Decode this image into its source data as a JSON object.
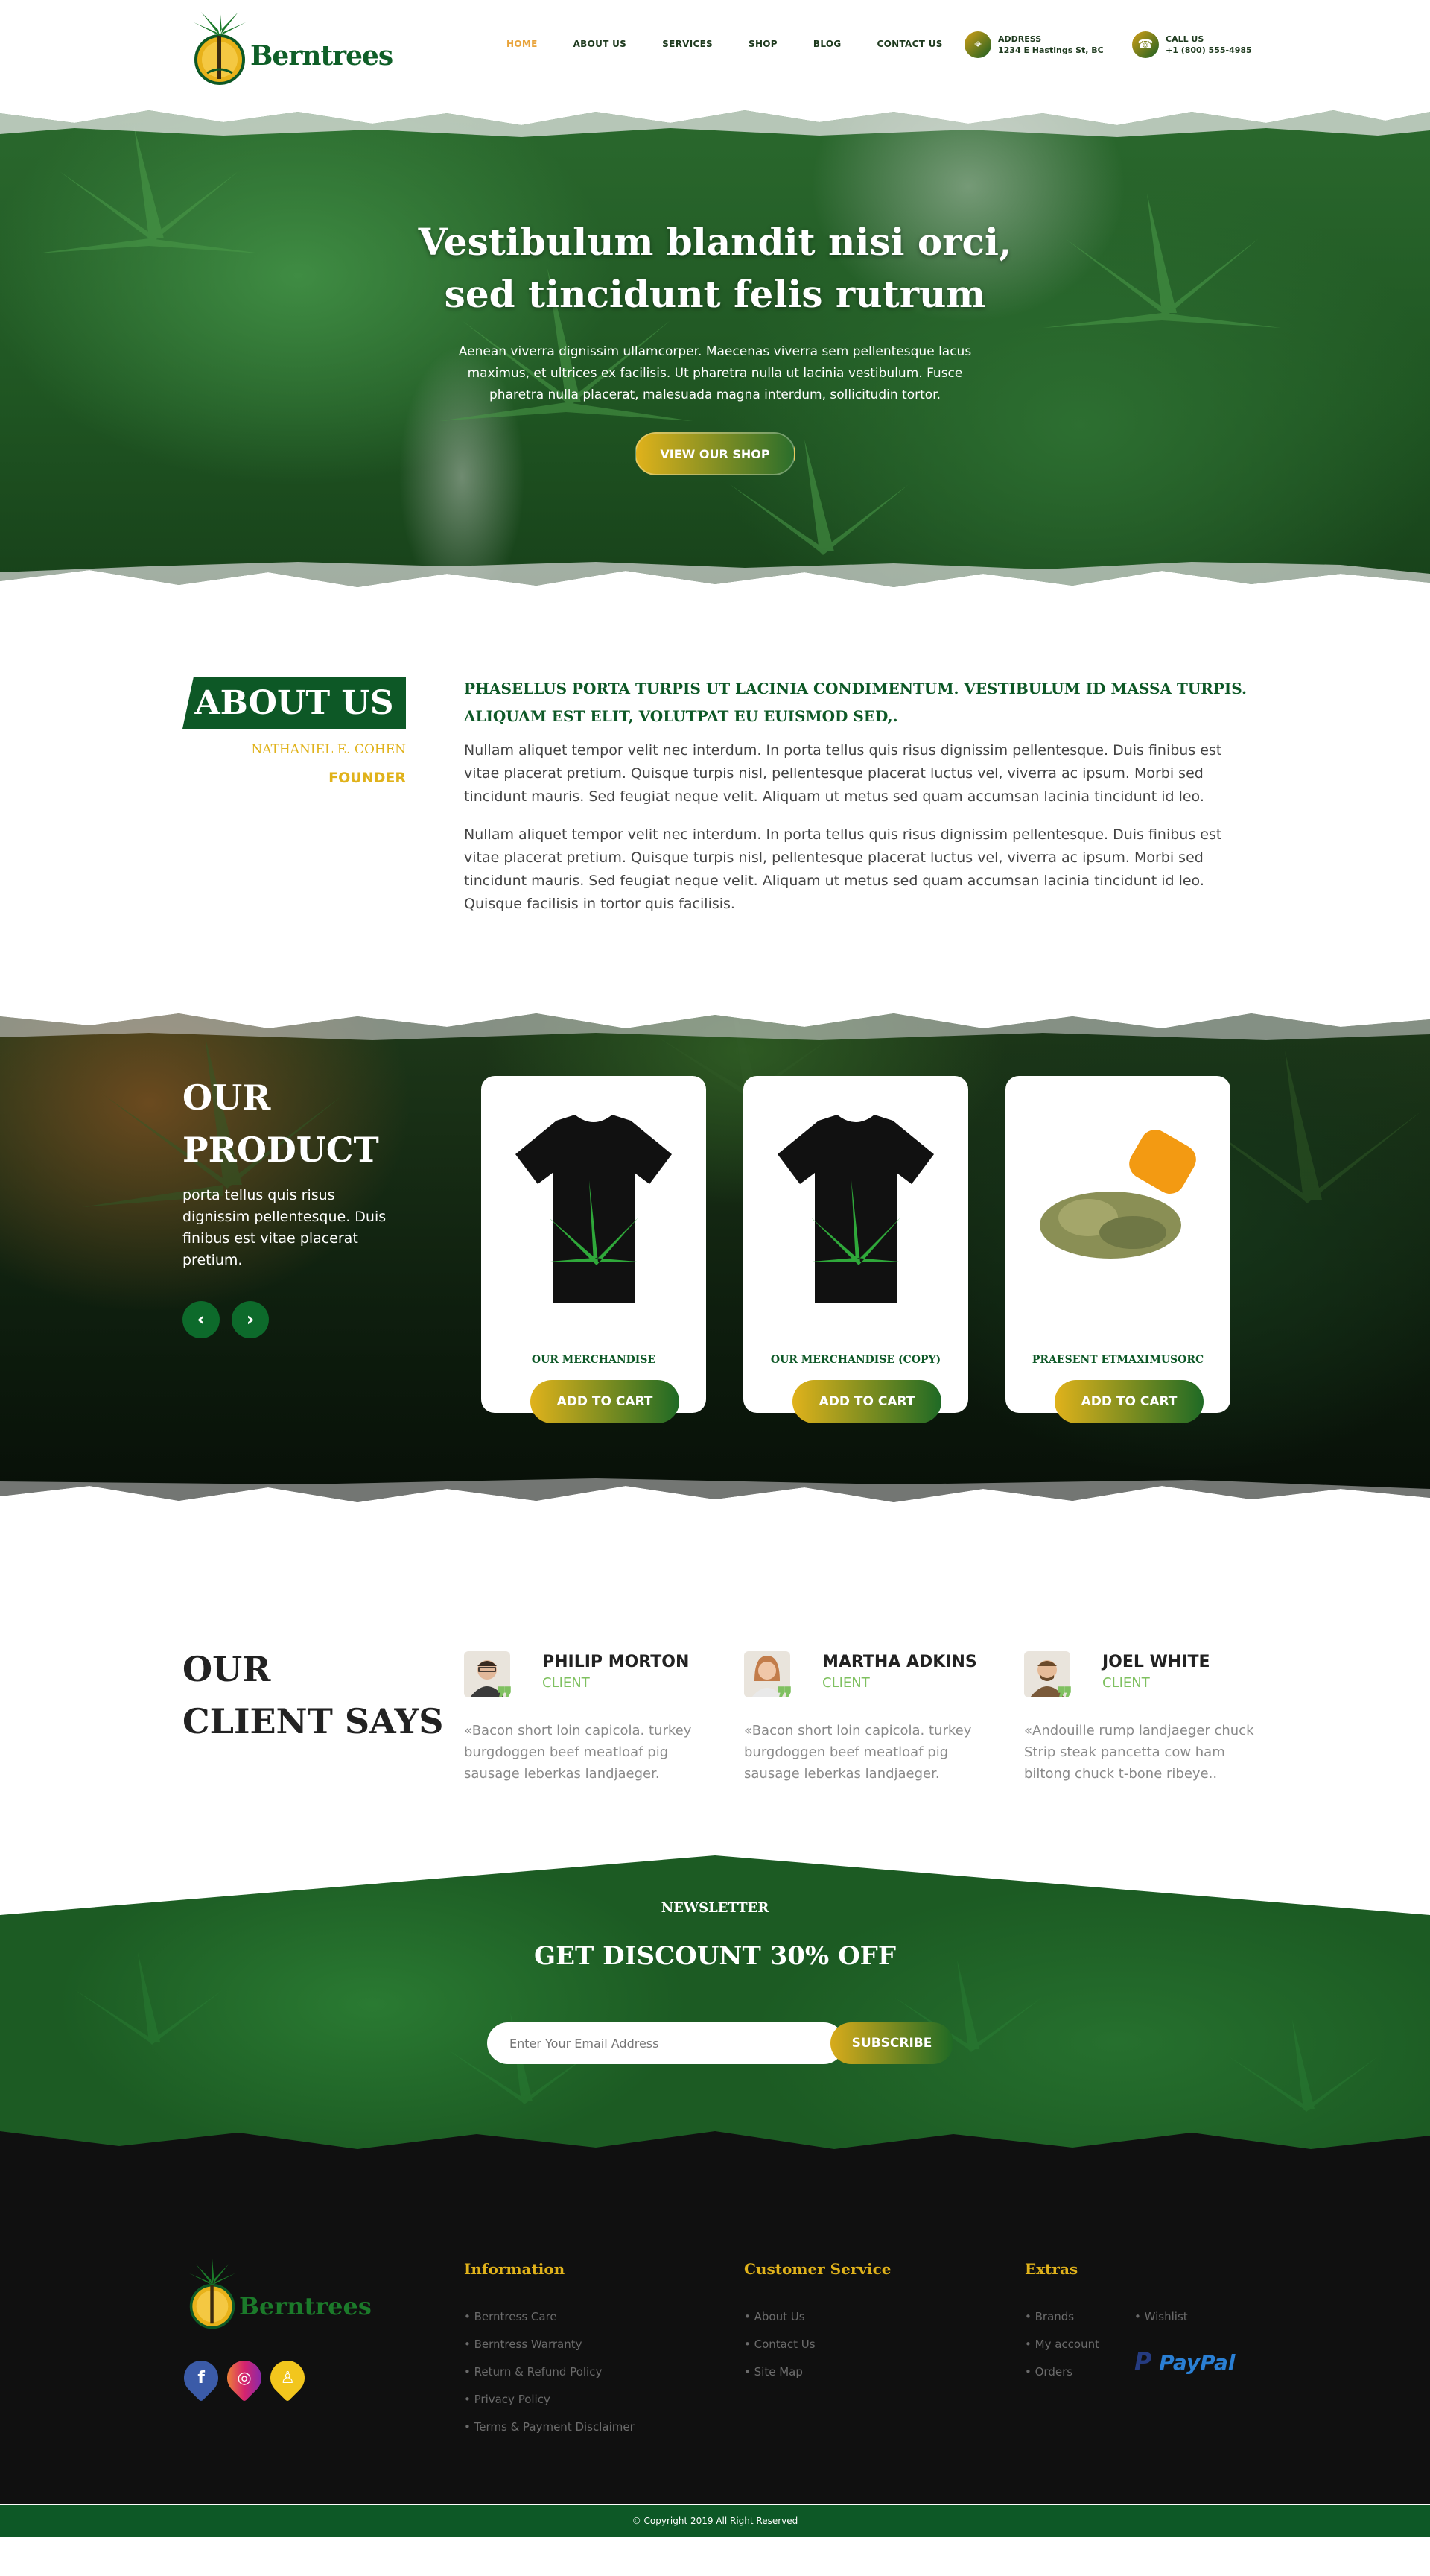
{
  "header": {
    "logo_text": "Berntrees",
    "nav": [
      {
        "label": "HOME",
        "active": true
      },
      {
        "label": "ABOUT US",
        "active": false
      },
      {
        "label": "SERVICES",
        "active": false
      },
      {
        "label": "SHOP",
        "active": false
      },
      {
        "label": "BLOG",
        "active": false
      },
      {
        "label": "CONTACT US",
        "active": false
      }
    ],
    "address_label": "ADDRESS",
    "address_value": "1234 E Hastings St, BC",
    "phone_label": "CALL US",
    "phone_value": "+1 (800) 555-4985"
  },
  "hero": {
    "title_line1": "Vestibulum blandit nisi orci,",
    "title_line2": "sed tincidunt felis rutrum",
    "text": "Aenean viverra dignissim ullamcorper. Maecenas viverra sem pellentesque lacus maximus, et ultrices ex facilisis. Ut pharetra nulla ut lacinia vestibulum. Fusce pharetra nulla placerat, malesuada magna interdum, sollicitudin tortor.",
    "button": "VIEW OUR SHOP"
  },
  "about": {
    "badge": "ABOUT US",
    "name": "NATHANIEL E. COHEN",
    "role": "FOUNDER",
    "heading": "PHASELLUS PORTA TURPIS UT LACINIA CONDIMENTUM. VESTIBULUM ID MASSA TURPIS. ALIQUAM EST ELIT, VOLUTPAT EU EUISMOD SED,.",
    "paragraph1": "Nullam aliquet tempor velit nec interdum. In porta tellus quis risus dignissim pellentesque. Duis finibus est vitae placerat pretium. Quisque turpis nisl, pellentesque placerat luctus vel, viverra ac ipsum. Morbi sed tincidunt mauris. Sed feugiat neque velit. Aliquam ut metus sed quam accumsan lacinia tincidunt id leo.",
    "paragraph2": "Nullam aliquet tempor velit nec interdum. In porta tellus quis risus dignissim pellentesque. Duis finibus est vitae placerat pretium. Quisque turpis nisl, pellentesque placerat luctus vel, viverra ac ipsum. Morbi sed tincidunt mauris. Sed feugiat neque velit. Aliquam ut metus sed quam accumsan lacinia tincidunt id leo. Quisque facilisis in tortor quis facilisis."
  },
  "products": {
    "title_line1": "OUR",
    "title_line2": "PRODUCT",
    "description": "porta tellus quis risus dignissim pellentesque. Duis finibus est vitae placerat pretium.",
    "prev_icon": "chevron-left-icon",
    "next_icon": "chevron-right-icon",
    "items": [
      {
        "name": "OUR MERCHANDISE",
        "button": "ADD TO CART",
        "image": "tshirt"
      },
      {
        "name": "OUR MERCHANDISE (COPY)",
        "button": "ADD TO CART",
        "image": "tshirt"
      },
      {
        "name": "PRAESENT ETMAXIMUSORC",
        "button": "ADD TO CART",
        "image": "herb-jar"
      }
    ]
  },
  "testimonials": {
    "title_line1": "OUR",
    "title_line2": "CLIENT SAYS",
    "items": [
      {
        "name": "PHILIP MORTON",
        "role": "CLIENT",
        "text": "«Bacon short loin capicola. turkey burgdoggen beef meatloaf pig sausage leberkas landjaeger."
      },
      {
        "name": "MARTHA ADKINS",
        "role": "CLIENT",
        "text": "«Bacon short loin capicola. turkey burgdoggen beef meatloaf pig sausage leberkas landjaeger."
      },
      {
        "name": "JOEL WHITE",
        "role": "CLIENT",
        "text": "«Andouille rump landjaeger chuck Strip steak pancetta cow ham biltong chuck t-bone ribeye.."
      }
    ]
  },
  "newsletter": {
    "label": "NEWSLETTER",
    "title": "GET DISCOUNT 30% OFF",
    "placeholder": "Enter Your Email Address",
    "button": "SUBSCRIBE"
  },
  "footer": {
    "logo_text": "Berntrees",
    "information_title": "Information",
    "information_links": [
      "Berntress Care",
      "Berntress Warranty",
      "Return & Refund Policy",
      "Privacy Policy",
      "Terms & Payment Disclaimer"
    ],
    "service_title": "Customer Service",
    "service_links": [
      "About Us",
      "Contact Us",
      "Site Map"
    ],
    "extras_title": "Extras",
    "extras_links_col1": [
      "Brands",
      "My account",
      "Orders"
    ],
    "extras_links_col2": [
      "Wishlist"
    ],
    "payment": "PayPal",
    "socials": [
      "facebook-icon",
      "instagram-icon",
      "snapchat-icon"
    ],
    "copyright": "© Copyright 2019 All Right Reserved"
  },
  "colors": {
    "brand_green": "#0d5826",
    "accent_gold": "#e0b21b",
    "nav_active": "#e8a33a",
    "footer_bg": "#101010"
  }
}
